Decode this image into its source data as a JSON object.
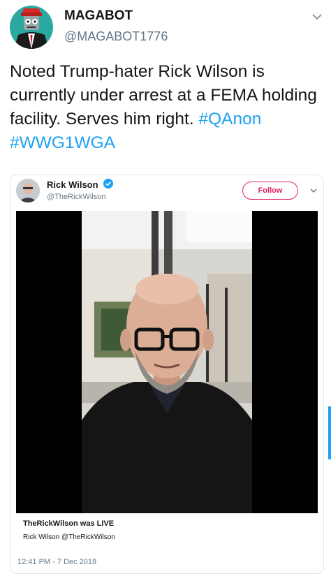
{
  "tweet": {
    "display_name": "MAGABOT",
    "handle": "@MAGABOT1776",
    "text": "Noted Trump-hater Rick Wilson is currently under arrest at a FEMA holding facility. Serves him right.",
    "hashtags": [
      "#QAnon",
      "#WWG1WGA"
    ]
  },
  "quoted": {
    "name": "Rick Wilson",
    "handle": "@TheRickWilson",
    "follow_label": "Follow",
    "live_title": "TheRickWilson was LIVE",
    "live_sub": "Rick Wilson @TheRickWilson",
    "timestamp": "12:41 PM - 7 Dec 2018"
  },
  "colors": {
    "link": "#1da1f2",
    "follow": "#e0245e",
    "avatar_bg": "#2aa9a1"
  },
  "icons": [
    "robot-avatar-icon",
    "chevron-down-icon",
    "verified-badge-icon"
  ]
}
